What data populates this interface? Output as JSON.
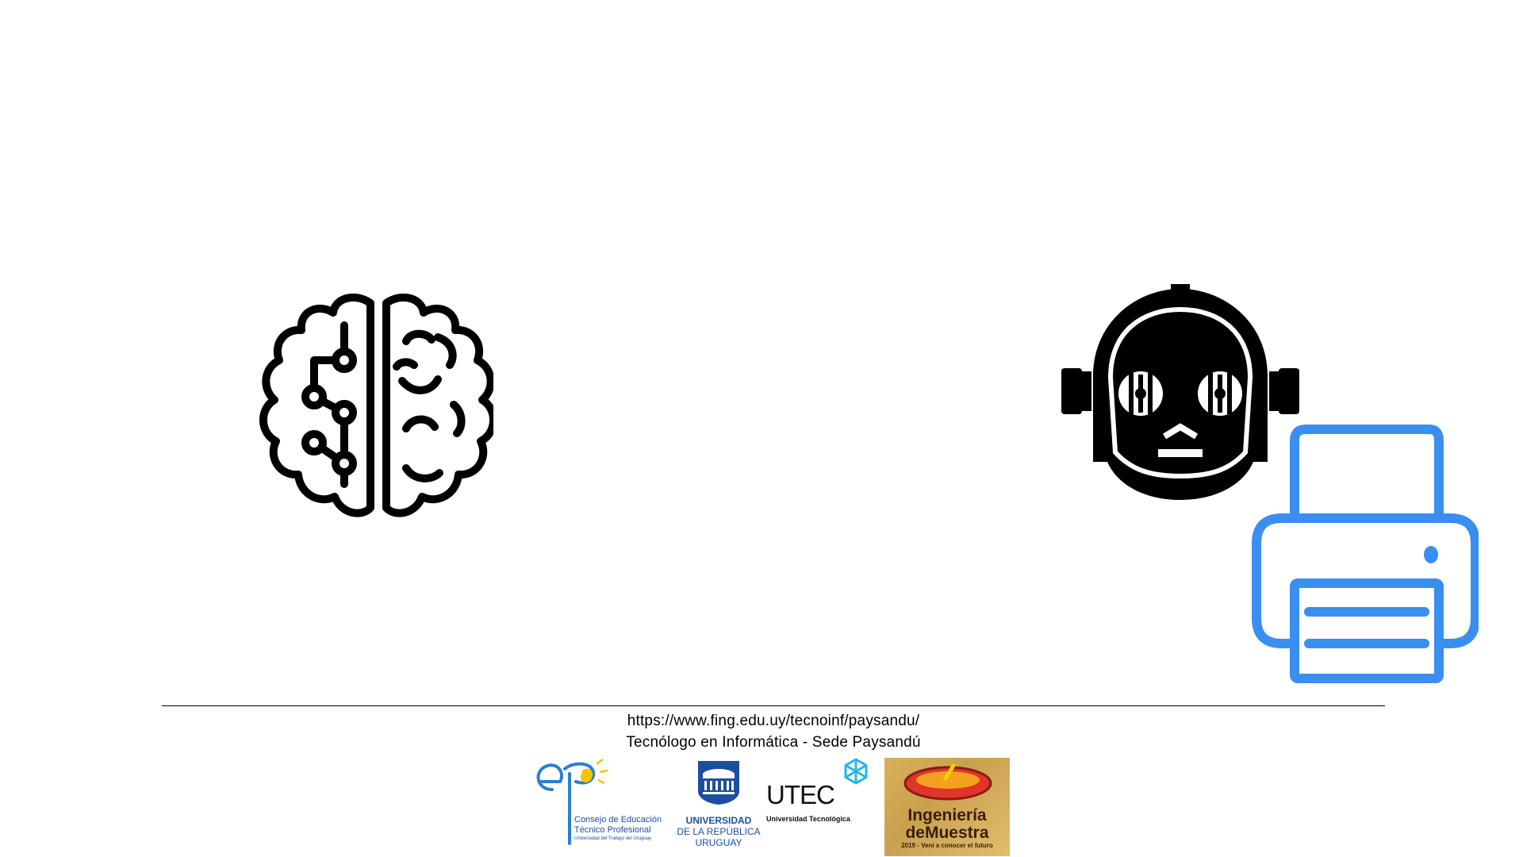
{
  "slide": {
    "icons": [
      "brain-circuit-icon",
      "robot-head-icon",
      "printer-icon"
    ],
    "accent_color": "#3a8ef0"
  },
  "footer": {
    "url": "https://www.fing.edu.uy/tecnoinf/paysandu/",
    "tagline": "Tecnólogo en Informática - Sede Paysandú",
    "logos": {
      "cetp": {
        "line1": "Consejo de Educación",
        "line2": "Técnico Profesional",
        "line3": "Universidad del Trabajo del Uruguay"
      },
      "udelar": {
        "line1": "UNIVERSIDAD",
        "line2": "DE LA REPÚBLICA",
        "line3": "URUGUAY"
      },
      "utec": {
        "name": "UTEC",
        "sub": "Universidad Tecnológica"
      },
      "idm": {
        "line1": "Ingeniería",
        "line2": "deMuestra",
        "line3": "2019 - Vení a conocer el futuro"
      }
    }
  }
}
